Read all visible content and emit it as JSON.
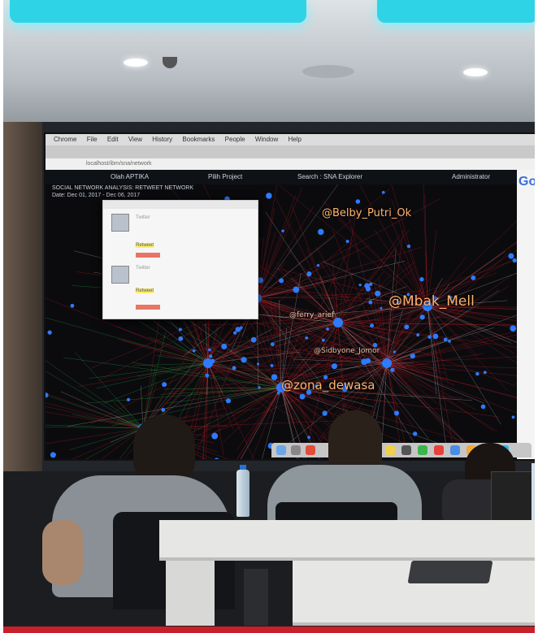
{
  "screen": {
    "menu": [
      "Chrome",
      "File",
      "Edit",
      "View",
      "History",
      "Bookmarks",
      "People",
      "Window",
      "Help"
    ],
    "url": "localhost/ibm/sna/network",
    "app": {
      "left": "Olah APTIKA",
      "center": "Pilih Project",
      "search": "Search : SNA Explorer",
      "right": "Administrator"
    },
    "meta_lines": [
      "SOCIAL NETWORK ANALYSIS: RETWEET NETWORK",
      "Date: Dec 01, 2017 - Dec 06, 2017"
    ],
    "popup": {
      "entries": [
        "Twitter",
        "Retweet",
        "Twitter",
        "Retweet"
      ],
      "highlight": "Retweet"
    },
    "handles": [
      "@Belby_Putri_Ok",
      "@Mbak_Mell",
      "@zona_dewasa",
      "@ferry_arief",
      "@Sidbyone_Jomor"
    ],
    "side_text": "Go"
  },
  "colors": {
    "edge_red": "#e0202a",
    "edge_green": "#27c24a",
    "node_blue": "#2d7bff",
    "label_orange": "#ffb46b"
  }
}
